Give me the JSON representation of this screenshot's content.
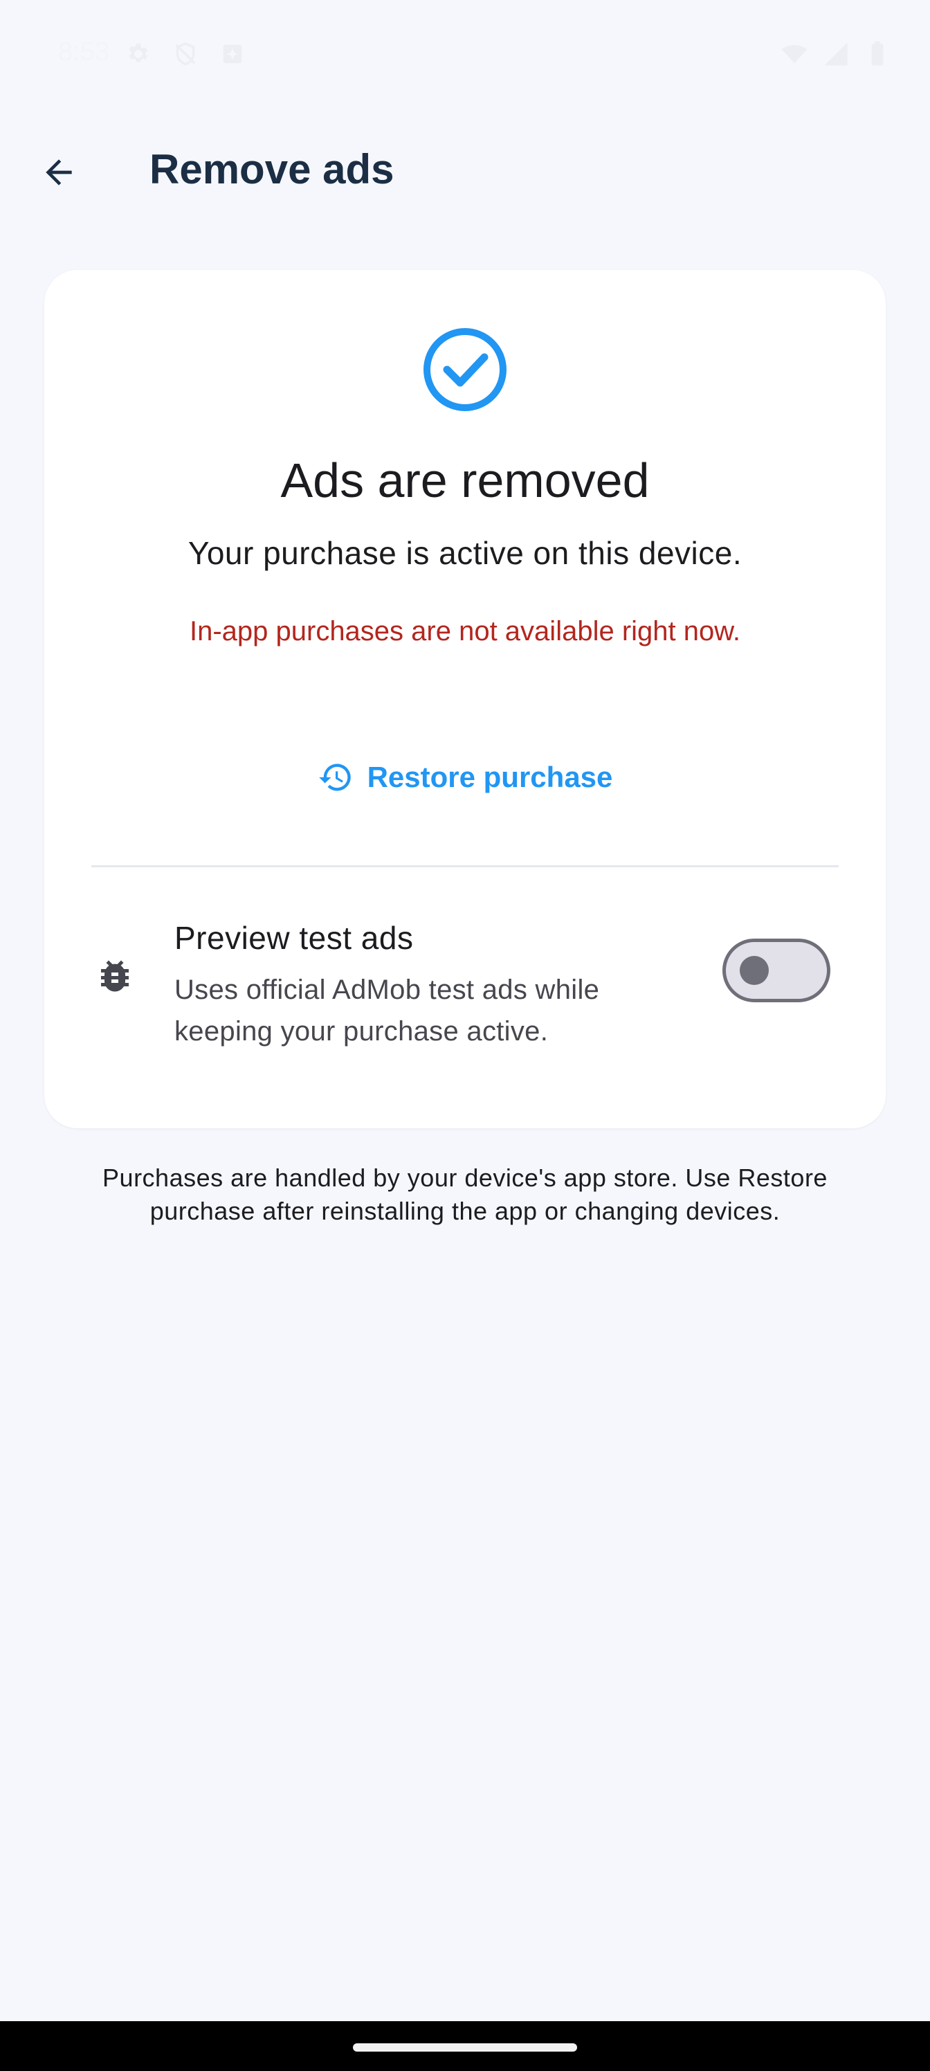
{
  "status_bar": {
    "time": "8:53",
    "left_icons": [
      "settings-icon",
      "shield-off-icon",
      "app-notification-icon"
    ],
    "right_icons": [
      "wifi-icon",
      "cell-signal-icon",
      "battery-icon"
    ]
  },
  "app_bar": {
    "title": "Remove ads",
    "back_icon": "arrow-back-icon"
  },
  "card": {
    "status_icon": "check-circle-icon",
    "title": "Ads are removed",
    "subtitle": "Your purchase is active on this device.",
    "error": "In-app purchases are not available right now.",
    "restore_label": "Restore purchase",
    "restore_icon": "history-icon",
    "test_ads": {
      "icon": "bug-icon",
      "title": "Preview test ads",
      "description": "Uses official AdMob test ads while keeping your purchase active.",
      "enabled": false
    }
  },
  "footer_note": "Purchases are handled by your device's app store. Use Restore purchase after reinstalling the app or changing devices.",
  "colors": {
    "accent": "#2196f3",
    "error": "#b3261e",
    "title": "#1b2e44",
    "background": "#f5f7fc",
    "card": "#ffffff"
  }
}
